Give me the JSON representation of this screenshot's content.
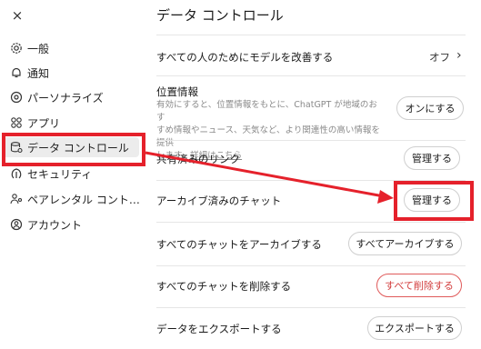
{
  "sidebar": {
    "close_icon": "×",
    "items": [
      {
        "label": "一般",
        "icon": "gear-icon"
      },
      {
        "label": "通知",
        "icon": "bell-icon"
      },
      {
        "label": "パーソナライズ",
        "icon": "personalize-icon"
      },
      {
        "label": "アプリ",
        "icon": "apps-icon"
      },
      {
        "label": "データ コントロール",
        "icon": "database-icon",
        "active": true
      },
      {
        "label": "セキュリティ",
        "icon": "security-icon"
      },
      {
        "label": "ペアレンタル コント…",
        "icon": "parental-icon"
      },
      {
        "label": "アカウント",
        "icon": "account-icon"
      }
    ]
  },
  "main": {
    "title": "データ コントロール",
    "rows": {
      "improve": {
        "label": "すべての人のためにモデルを改善する",
        "value": "オフ",
        "chevron": "›"
      },
      "location": {
        "label": "位置情報",
        "desc_line1": "有効にすると、位置情報をもとに、ChatGPT が地域のおす",
        "desc_line2": "すめ情報やニュース、天気など、より関連性の高い情報を提供",
        "desc_line3a": "します。",
        "desc_link": "詳細はこちら",
        "button": "オンにする"
      },
      "shared_links": {
        "label": "共有済みのリンク",
        "button": "管理する"
      },
      "archived": {
        "label": "アーカイブ済みのチャット",
        "button": "管理する"
      },
      "archive_all": {
        "label": "すべてのチャットをアーカイブする",
        "button": "すべてアーカイブする"
      },
      "delete_all": {
        "label": "すべてのチャットを削除する",
        "button": "すべて削除する"
      },
      "export": {
        "label": "データをエクスポートする",
        "button": "エクスポートする"
      }
    }
  },
  "colors": {
    "annotation_red": "#e5212b",
    "danger_red": "#d23d3d",
    "active_bg": "#ececec"
  }
}
